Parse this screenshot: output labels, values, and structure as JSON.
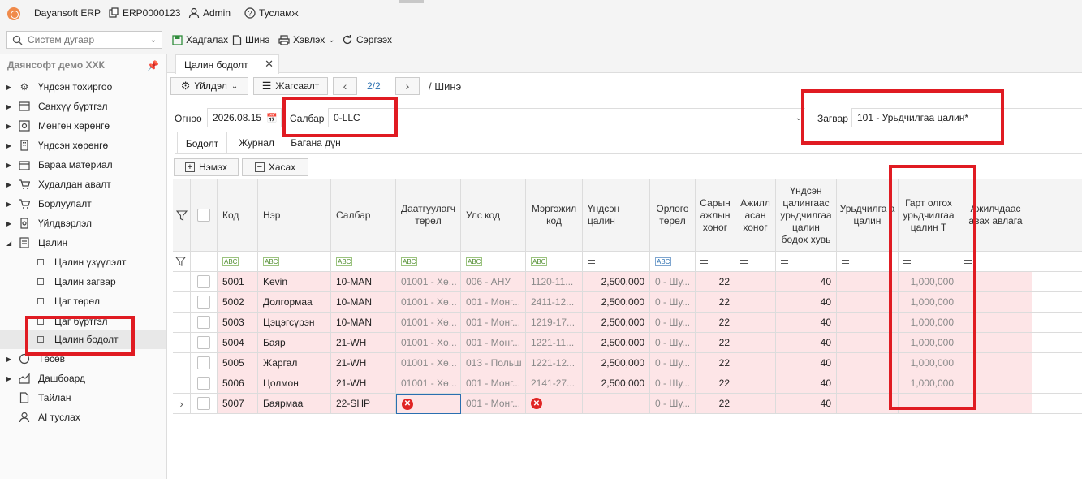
{
  "topbar": {
    "app_name": "Dayansoft ERP",
    "code": "ERP0000123",
    "user": "Admin",
    "help": "Тусламж"
  },
  "menubar": {
    "search_placeholder": "Систем дугаар",
    "save": "Хадгалах",
    "new": "Шинэ",
    "print": "Хэвлэх",
    "refresh": "Сэргээх"
  },
  "sidebar": {
    "company": "Даянсофт демо ХХК",
    "items": [
      {
        "label": "Үндсэн тохиргоо",
        "icon": "gear-icon"
      },
      {
        "label": "Санхүү бүртгэл",
        "icon": "ledger-icon"
      },
      {
        "label": "Мөнгөн хөрөнгө",
        "icon": "cash-icon"
      },
      {
        "label": "Үндсэн хөрөнгө",
        "icon": "building-icon"
      },
      {
        "label": "Бараа материал",
        "icon": "box-icon"
      },
      {
        "label": "Худалдан авалт",
        "icon": "cart-icon"
      },
      {
        "label": "Борлуулалт",
        "icon": "cart-icon"
      },
      {
        "label": "Үйлдвэрлэл",
        "icon": "factory-icon"
      },
      {
        "label": "Цалин",
        "icon": "payroll-icon"
      },
      {
        "label": "Төсөв",
        "icon": "budget-icon"
      },
      {
        "label": "Дашбоард",
        "icon": "dashboard-icon"
      },
      {
        "label": "Тайлан",
        "icon": "report-icon"
      },
      {
        "label": "AI туслах",
        "icon": "ai-icon"
      }
    ],
    "sub_items": [
      "Цалин үзүүлэлт",
      "Цалин загвар",
      "Цаг төрөл",
      "Цаг бүртгэл",
      "Цалин бодолт"
    ]
  },
  "tab": {
    "label": "Цалин бодолт"
  },
  "toolbar": {
    "action": "Үйлдэл",
    "sort": "Жагсаалт",
    "pager": "2/2",
    "crumb": "/ Шинэ"
  },
  "form": {
    "date_label": "Огноо",
    "date_value": "2026.08.15",
    "branch_label": "Салбар",
    "branch_value": "0-LLC",
    "template_label": "Загвар",
    "template_value": "101 - Урьдчилгаа цалин*"
  },
  "subtabs": {
    "calc": "Бодолт",
    "journal": "Журнал",
    "column_sum": "Багана дүн"
  },
  "grid_toolbar": {
    "add": "Нэмэх",
    "remove": "Хасах"
  },
  "grid": {
    "headers": {
      "code": "Код",
      "name": "Нэр",
      "branch": "Салбар",
      "insurance_type": "Даатгуулагч төрөл",
      "country_code": "Улс код",
      "profession_code": "Мэргэжил код",
      "base_salary": "Үндсэн цалин",
      "income_type": "Орлого төрөл",
      "work_days": "Сарын ажлын хоног",
      "worked_days": "Ажилл асан хоног",
      "advance_ratio": "Үндсэн цалингаас урьдчилгаа цалин бодох хувь",
      "advance": "Урьдчилга а цалин",
      "net_advance": "Гарт олгох урьдчилгаа цалин Т",
      "deduction": "Ажилчдаас авах авлага"
    },
    "rows": [
      {
        "code": "5001",
        "name": "Kevin",
        "branch": "10-MAN",
        "insurance_type": "01001 - Хө...",
        "country_code": "006 - АНУ",
        "profession_code": "1120-11...",
        "base_salary": "2,500,000",
        "income_type": "0 - Шу...",
        "work_days": "22",
        "advance_ratio": "40",
        "net_advance": "1,000,000"
      },
      {
        "code": "5002",
        "name": "Долгормаа",
        "branch": "10-MAN",
        "insurance_type": "01001 - Хө...",
        "country_code": "001 - Монг...",
        "profession_code": "2411-12...",
        "base_salary": "2,500,000",
        "income_type": "0 - Шу...",
        "work_days": "22",
        "advance_ratio": "40",
        "net_advance": "1,000,000"
      },
      {
        "code": "5003",
        "name": "Цэцэгсүрэн",
        "branch": "10-MAN",
        "insurance_type": "01001 - Хө...",
        "country_code": "001 - Монг...",
        "profession_code": "1219-17...",
        "base_salary": "2,500,000",
        "income_type": "0 - Шу...",
        "work_days": "22",
        "advance_ratio": "40",
        "net_advance": "1,000,000"
      },
      {
        "code": "5004",
        "name": "Баяр",
        "branch": "21-WH",
        "insurance_type": "01001 - Хө...",
        "country_code": "001 - Монг...",
        "profession_code": "1221-11...",
        "base_salary": "2,500,000",
        "income_type": "0 - Шу...",
        "work_days": "22",
        "advance_ratio": "40",
        "net_advance": "1,000,000"
      },
      {
        "code": "5005",
        "name": "Жаргал",
        "branch": "21-WH",
        "insurance_type": "01001 - Хө...",
        "country_code": "013 - Польш",
        "profession_code": "1221-12...",
        "base_salary": "2,500,000",
        "income_type": "0 - Шу...",
        "work_days": "22",
        "advance_ratio": "40",
        "net_advance": "1,000,000"
      },
      {
        "code": "5006",
        "name": "Цолмон",
        "branch": "21-WH",
        "insurance_type": "01001 - Хө...",
        "country_code": "001 - Монг...",
        "profession_code": "2141-27...",
        "base_salary": "2,500,000",
        "income_type": "0 - Шу...",
        "work_days": "22",
        "advance_ratio": "40",
        "net_advance": "1,000,000"
      },
      {
        "code": "5007",
        "name": "Баярмаа",
        "branch": "22-SHP",
        "insurance_type": "",
        "country_code": "001 - Монг...",
        "profession_code": "",
        "base_salary": "",
        "income_type": "0 - Шу...",
        "work_days": "22",
        "advance_ratio": "40",
        "net_advance": ""
      }
    ]
  },
  "colors": {
    "row_bg": "#fde5e7",
    "highlight": "#e01b22",
    "accent": "#2a6fb0",
    "error": "#e02424"
  }
}
